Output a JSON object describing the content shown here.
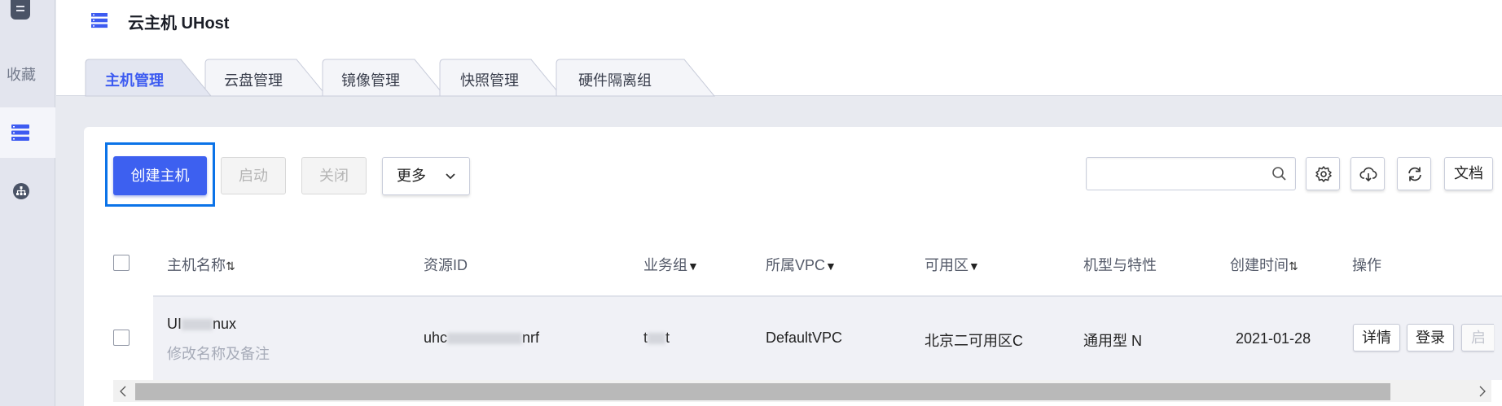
{
  "sidebar": {
    "items": [
      {
        "label": "收藏"
      }
    ]
  },
  "header": {
    "title": "云主机 UHost"
  },
  "tabs": [
    {
      "label": "主机管理",
      "active": true
    },
    {
      "label": "云盘管理",
      "active": false
    },
    {
      "label": "镜像管理",
      "active": false
    },
    {
      "label": "快照管理",
      "active": false
    },
    {
      "label": "硬件隔离组",
      "active": false
    }
  ],
  "toolbar": {
    "create_label": "创建主机",
    "start_label": "启动",
    "stop_label": "关闭",
    "more_label": "更多",
    "search_placeholder": "",
    "docs_label": "文档"
  },
  "table": {
    "columns": [
      {
        "label": "主机名称",
        "sort": "⇅"
      },
      {
        "label": "资源ID",
        "sort": ""
      },
      {
        "label": "业务组",
        "sort": "▼"
      },
      {
        "label": "所属VPC",
        "sort": "▼"
      },
      {
        "label": "可用区",
        "sort": "▼"
      },
      {
        "label": "机型与特性",
        "sort": ""
      },
      {
        "label": "创建时间",
        "sort": "⇅"
      },
      {
        "label": "操作",
        "sort": ""
      }
    ],
    "rows": [
      {
        "name_prefix": "UI",
        "name_suffix": "nux",
        "remark": "修改名称及备注",
        "resource_prefix": "uhc",
        "resource_suffix": "nrf",
        "group_prefix": "t",
        "group_suffix": "t",
        "vpc": "DefaultVPC",
        "zone": "北京二可用区C",
        "type": "通用型 N",
        "created": "2021-01-28",
        "actions": [
          "详情",
          "登录",
          "启动"
        ]
      }
    ]
  },
  "colors": {
    "accent": "#3d60f0",
    "active_tab_text": "#3d5bf1",
    "highlight_outline": "#0b73e8"
  },
  "icons": [
    "list-icon",
    "server-list-icon",
    "network-icon",
    "search-icon",
    "gear-icon",
    "cloud-download-icon",
    "refresh-icon",
    "chevron-down-icon"
  ]
}
